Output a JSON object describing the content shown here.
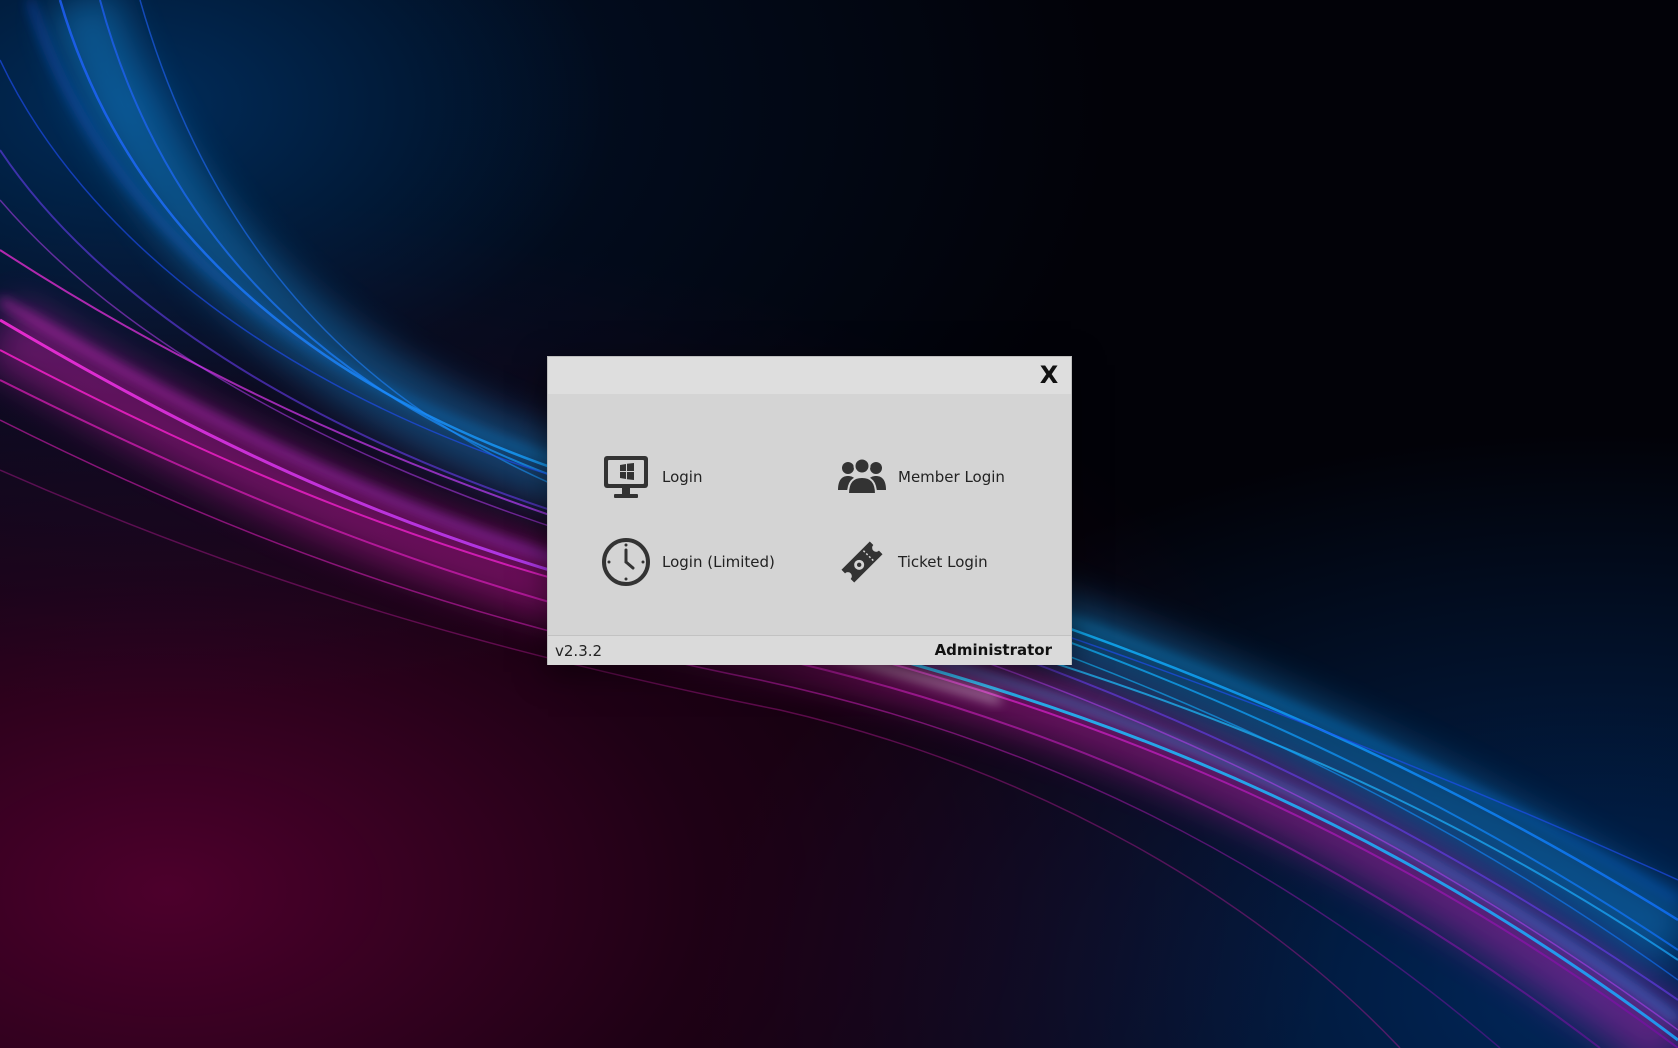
{
  "dialog": {
    "close_label": "X",
    "options": [
      {
        "label": "Login",
        "icon": "monitor-windows-icon"
      },
      {
        "label": "Member Login",
        "icon": "users-group-icon"
      },
      {
        "label": "Login (Limited)",
        "icon": "clock-icon"
      },
      {
        "label": "Ticket Login",
        "icon": "ticket-icon"
      }
    ]
  },
  "status": {
    "version": "v2.3.2",
    "user": "Administrator"
  },
  "colors": {
    "dialog_bg": "#d4d4d4",
    "titlebar_bg": "#dedede",
    "icon_color": "#333333",
    "wallpaper_pink": "#ff2ee0",
    "wallpaper_blue": "#1aa8ff"
  }
}
